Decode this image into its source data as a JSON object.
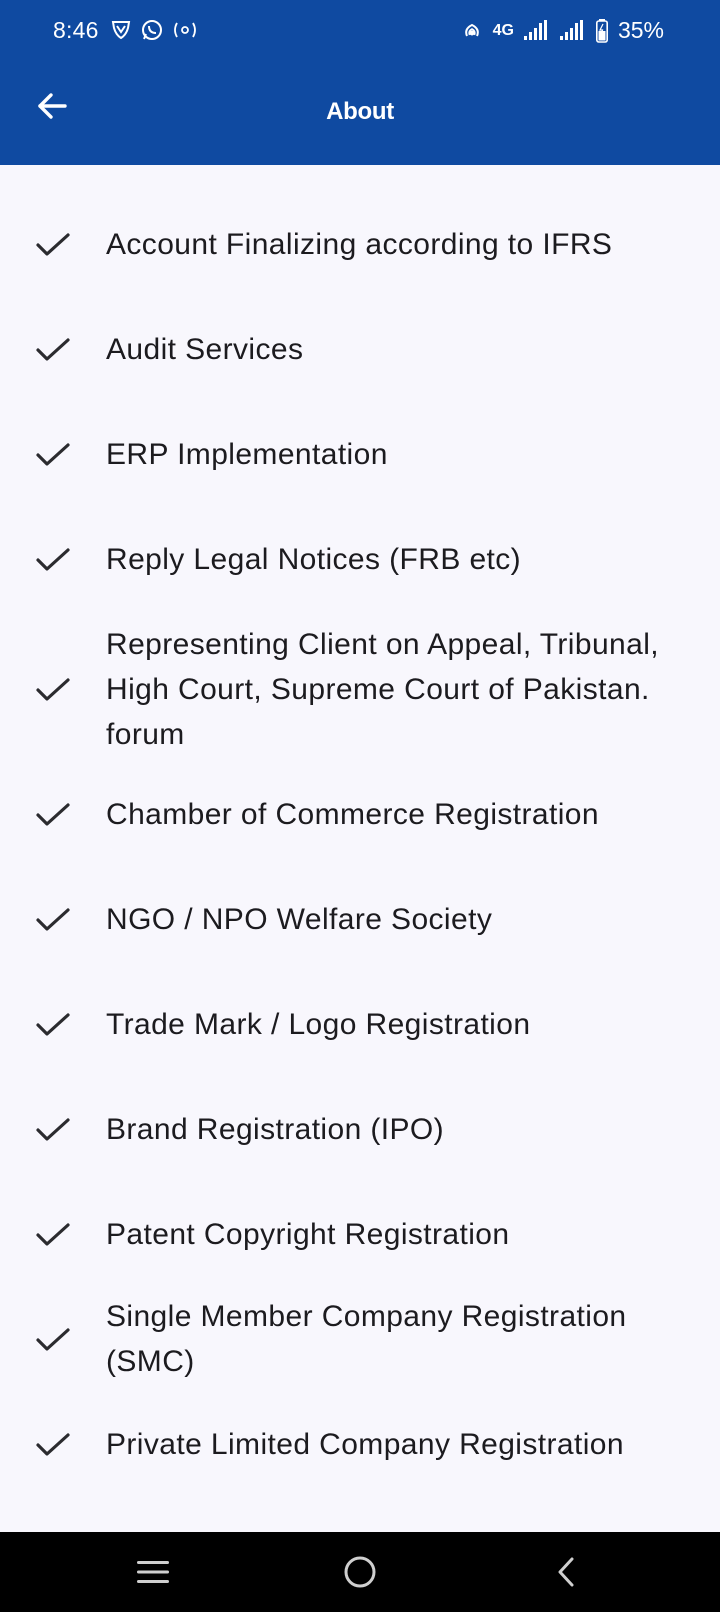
{
  "status_bar": {
    "time": "8:46",
    "network": "4G",
    "battery": "35%"
  },
  "app_bar": {
    "title": "About",
    "back_icon": "arrow-back-icon"
  },
  "services": [
    {
      "label": "Account Finalizing according to IFRS"
    },
    {
      "label": "Audit Services"
    },
    {
      "label": "ERP Implementation"
    },
    {
      "label": "Reply Legal Notices (FRB etc)"
    },
    {
      "label": "Representing Client on Appeal, Tribunal, High Court, Supreme Court of Pakistan. forum"
    },
    {
      "label": "Chamber of Commerce Registration"
    },
    {
      "label": "NGO / NPO Welfare Society"
    },
    {
      "label": "Trade Mark / Logo Registration"
    },
    {
      "label": "Brand Registration (IPO)"
    },
    {
      "label": "Patent Copyright Registration"
    },
    {
      "label": "Single Member Company Registration (SMC)"
    },
    {
      "label": "Private Limited Company Registration"
    }
  ],
  "colors": {
    "primary": "#0f4aa1",
    "background": "#f8f7fd",
    "text": "#1c1b1f"
  },
  "nav_bar": {
    "icons": [
      "recent-apps-icon",
      "home-icon",
      "back-icon"
    ]
  }
}
